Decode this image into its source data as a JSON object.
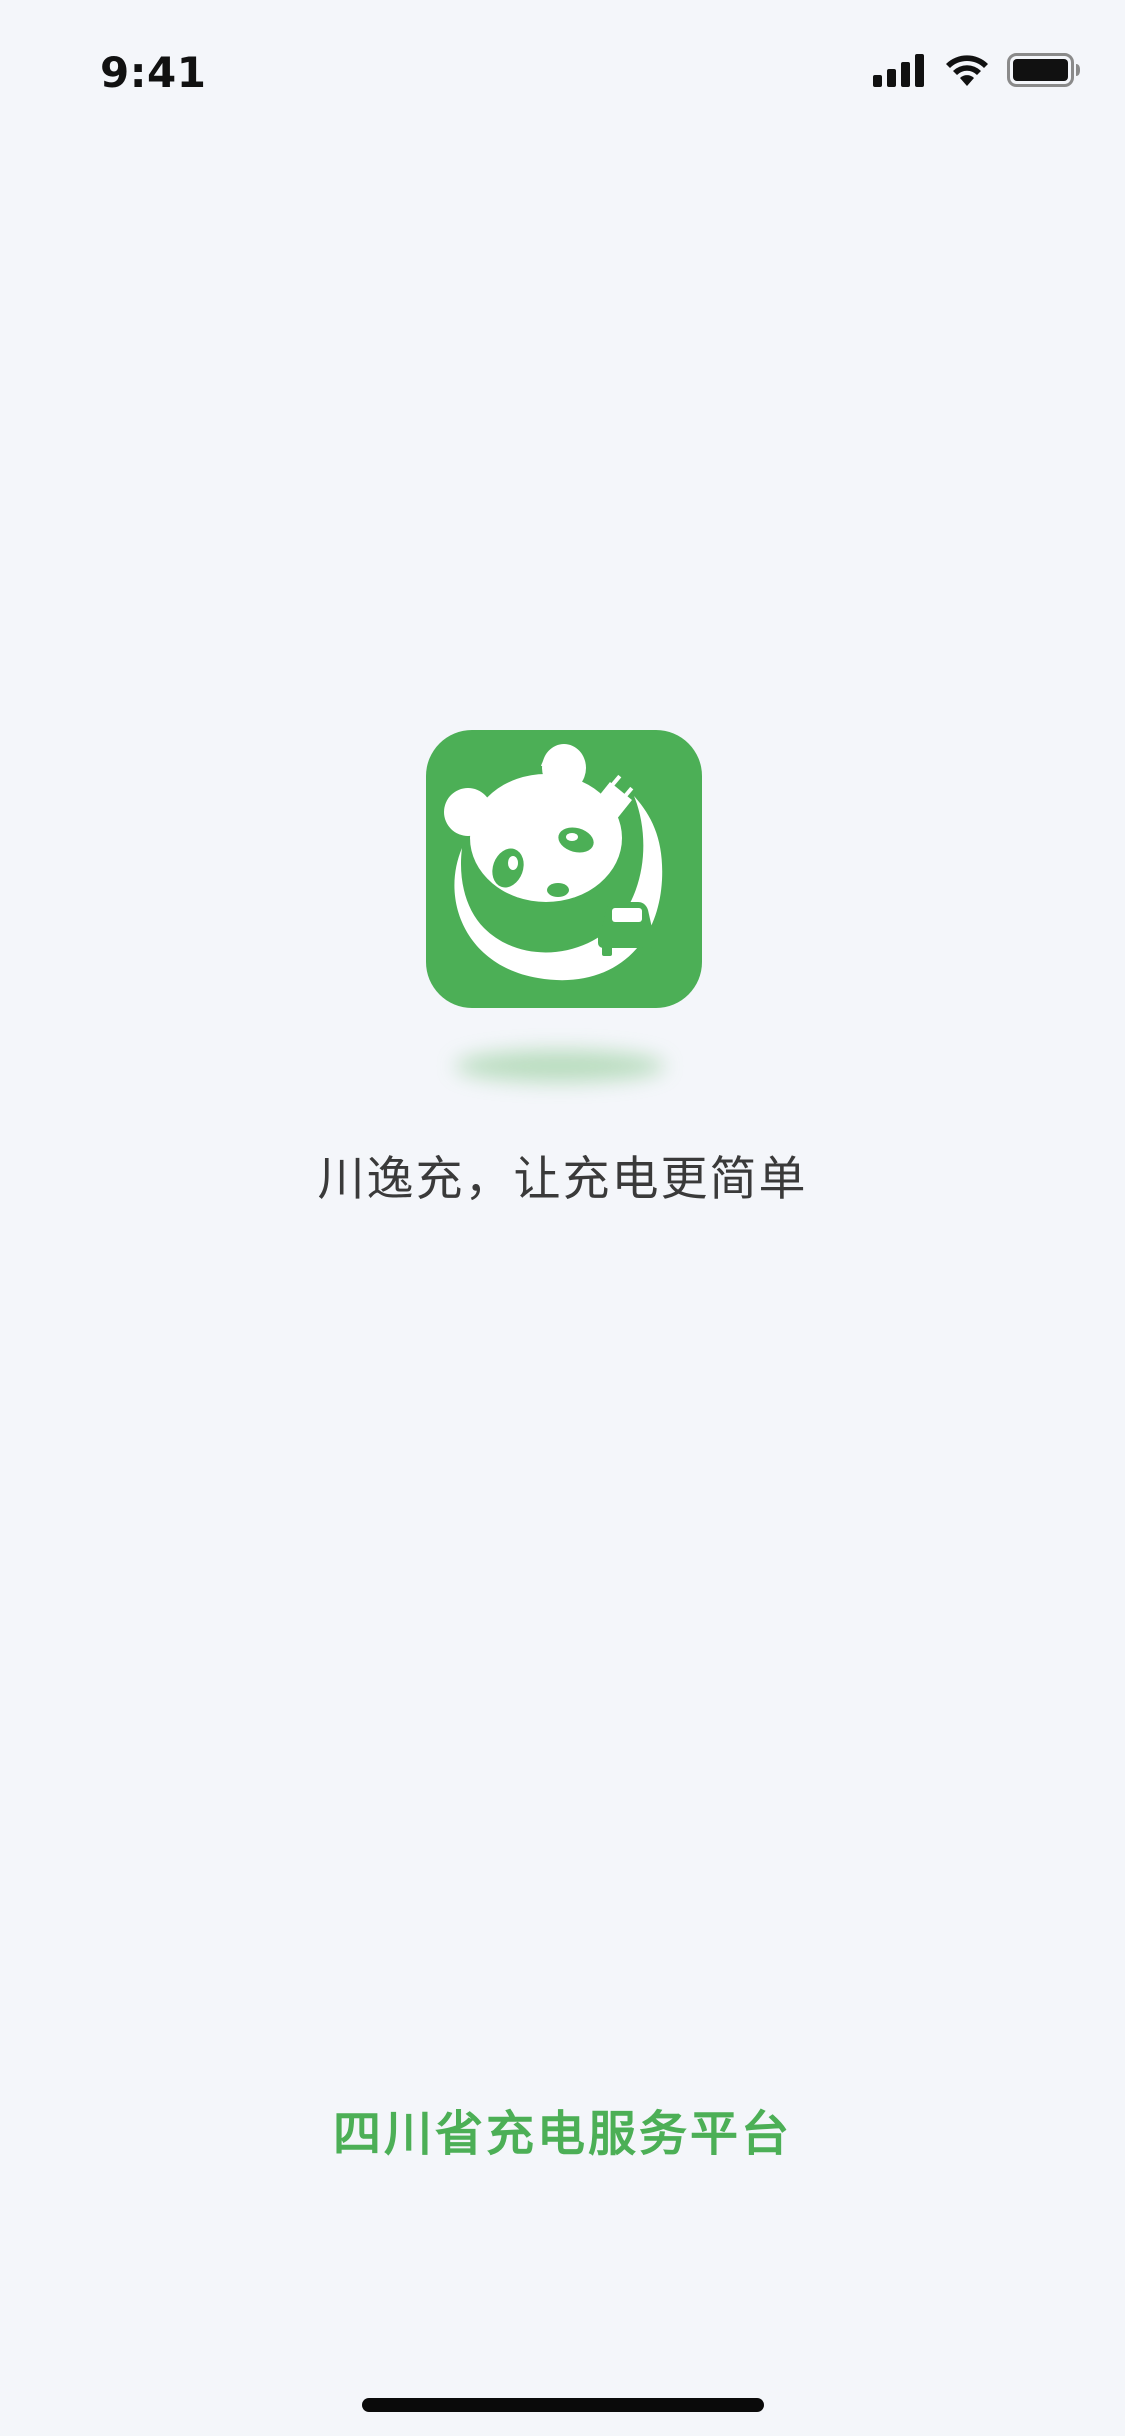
{
  "status_bar": {
    "time": "9:41",
    "icons": [
      "cellular-signal-icon",
      "wifi-icon",
      "battery-icon"
    ]
  },
  "splash": {
    "logo_icon": "panda-ev-charging-logo-icon",
    "tagline": "川逸充，让充电更简单",
    "platform_name": "四川省充电服务平台"
  },
  "colors": {
    "brand_green": "#4caf56",
    "background": "#f4f6fa",
    "tagline_text": "#3a3a3a"
  }
}
